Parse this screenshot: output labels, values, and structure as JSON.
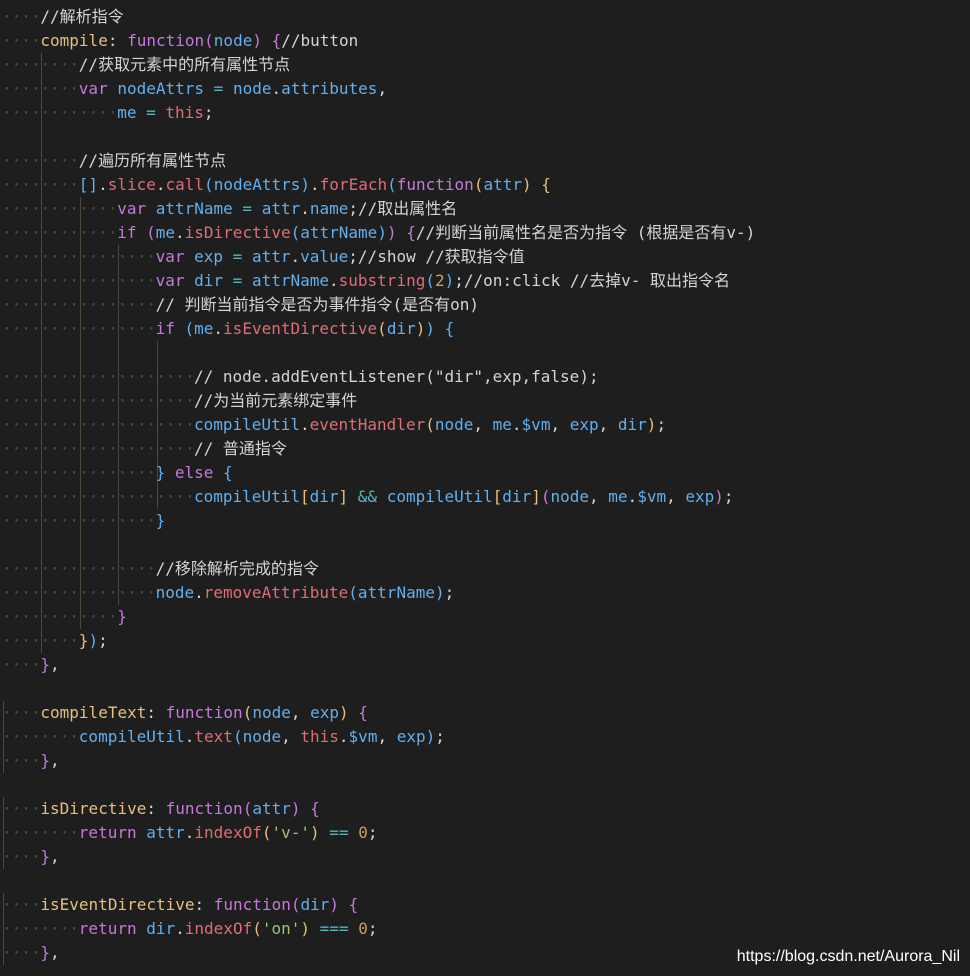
{
  "editor": {
    "lines": [
      [
        {
          "t": "//解析指令",
          "c": "comment"
        }
      ],
      [
        {
          "t": "compile",
          "c": "key"
        },
        {
          "t": ": ",
          "c": "plain"
        },
        {
          "t": "function",
          "c": "kw"
        },
        {
          "t": "(",
          "c": "b2"
        },
        {
          "t": "node",
          "c": "var"
        },
        {
          "t": ") ",
          "c": "b2"
        },
        {
          "t": "{",
          "c": "b2"
        },
        {
          "t": "//button",
          "c": "comment"
        }
      ],
      [
        {
          "t": "//获取元素中的所有属性节点",
          "c": "comment"
        }
      ],
      [
        {
          "t": "var ",
          "c": "kw"
        },
        {
          "t": "nodeAttrs",
          "c": "var"
        },
        {
          "t": " = ",
          "c": "op"
        },
        {
          "t": "node",
          "c": "var"
        },
        {
          "t": ".",
          "c": "plain"
        },
        {
          "t": "attributes",
          "c": "var"
        },
        {
          "t": ",",
          "c": "plain"
        }
      ],
      [
        {
          "t": "me",
          "c": "var"
        },
        {
          "t": " = ",
          "c": "op"
        },
        {
          "t": "this",
          "c": "this"
        },
        {
          "t": ";",
          "c": "plain"
        }
      ],
      [],
      [
        {
          "t": "//遍历所有属性节点",
          "c": "comment"
        }
      ],
      [
        {
          "t": "[]",
          "c": "b3"
        },
        {
          "t": ".",
          "c": "plain"
        },
        {
          "t": "slice",
          "c": "fn"
        },
        {
          "t": ".",
          "c": "plain"
        },
        {
          "t": "call",
          "c": "fn"
        },
        {
          "t": "(",
          "c": "b3"
        },
        {
          "t": "nodeAttrs",
          "c": "var"
        },
        {
          "t": ")",
          "c": "b3"
        },
        {
          "t": ".",
          "c": "plain"
        },
        {
          "t": "forEach",
          "c": "fn"
        },
        {
          "t": "(",
          "c": "b3"
        },
        {
          "t": "function",
          "c": "kw"
        },
        {
          "t": "(",
          "c": "b1"
        },
        {
          "t": "attr",
          "c": "var"
        },
        {
          "t": ") ",
          "c": "b1"
        },
        {
          "t": "{",
          "c": "b1"
        }
      ],
      [
        {
          "t": "var ",
          "c": "kw"
        },
        {
          "t": "attrName",
          "c": "var"
        },
        {
          "t": " = ",
          "c": "op"
        },
        {
          "t": "attr",
          "c": "var"
        },
        {
          "t": ".",
          "c": "plain"
        },
        {
          "t": "name",
          "c": "var"
        },
        {
          "t": ";",
          "c": "plain"
        },
        {
          "t": "//取出属性名",
          "c": "comment"
        }
      ],
      [
        {
          "t": "if ",
          "c": "kw"
        },
        {
          "t": "(",
          "c": "b2"
        },
        {
          "t": "me",
          "c": "var"
        },
        {
          "t": ".",
          "c": "plain"
        },
        {
          "t": "isDirective",
          "c": "fn"
        },
        {
          "t": "(",
          "c": "b3"
        },
        {
          "t": "attrName",
          "c": "var"
        },
        {
          "t": ")",
          "c": "b3"
        },
        {
          "t": ")",
          "c": "b2"
        },
        {
          "t": " {",
          "c": "b2"
        },
        {
          "t": "//判断当前属性名是否为指令 (根据是否有v-)",
          "c": "comment"
        }
      ],
      [
        {
          "t": "var ",
          "c": "kw"
        },
        {
          "t": "exp",
          "c": "var"
        },
        {
          "t": " = ",
          "c": "op"
        },
        {
          "t": "attr",
          "c": "var"
        },
        {
          "t": ".",
          "c": "plain"
        },
        {
          "t": "value",
          "c": "var"
        },
        {
          "t": ";",
          "c": "plain"
        },
        {
          "t": "//show //获取指令值",
          "c": "comment"
        }
      ],
      [
        {
          "t": "var ",
          "c": "kw"
        },
        {
          "t": "dir",
          "c": "var"
        },
        {
          "t": " = ",
          "c": "op"
        },
        {
          "t": "attrName",
          "c": "var"
        },
        {
          "t": ".",
          "c": "plain"
        },
        {
          "t": "substring",
          "c": "fn"
        },
        {
          "t": "(",
          "c": "b3"
        },
        {
          "t": "2",
          "c": "num"
        },
        {
          "t": ")",
          "c": "b3"
        },
        {
          "t": ";",
          "c": "plain"
        },
        {
          "t": "//on:click //去掉v- 取出指令名",
          "c": "comment"
        }
      ],
      [
        {
          "t": "// 判断当前指令是否为事件指令(是否有on)",
          "c": "comment"
        }
      ],
      [
        {
          "t": "if ",
          "c": "kw"
        },
        {
          "t": "(",
          "c": "b3"
        },
        {
          "t": "me",
          "c": "var"
        },
        {
          "t": ".",
          "c": "plain"
        },
        {
          "t": "isEventDirective",
          "c": "fn"
        },
        {
          "t": "(",
          "c": "b1"
        },
        {
          "t": "dir",
          "c": "var"
        },
        {
          "t": ")",
          "c": "b1"
        },
        {
          "t": ")",
          "c": "b3"
        },
        {
          "t": " {",
          "c": "b3"
        }
      ],
      [],
      [
        {
          "t": "// node.addEventListener(\"dir\",exp,false);",
          "c": "comment"
        }
      ],
      [
        {
          "t": "//为当前元素绑定事件",
          "c": "comment"
        }
      ],
      [
        {
          "t": "compileUtil",
          "c": "var"
        },
        {
          "t": ".",
          "c": "plain"
        },
        {
          "t": "eventHandler",
          "c": "fn"
        },
        {
          "t": "(",
          "c": "b1"
        },
        {
          "t": "node",
          "c": "var"
        },
        {
          "t": ", ",
          "c": "plain"
        },
        {
          "t": "me",
          "c": "var"
        },
        {
          "t": ".",
          "c": "plain"
        },
        {
          "t": "$vm",
          "c": "var"
        },
        {
          "t": ", ",
          "c": "plain"
        },
        {
          "t": "exp",
          "c": "var"
        },
        {
          "t": ", ",
          "c": "plain"
        },
        {
          "t": "dir",
          "c": "var"
        },
        {
          "t": ")",
          "c": "b1"
        },
        {
          "t": ";",
          "c": "plain"
        }
      ],
      [
        {
          "t": "// 普通指令",
          "c": "comment"
        }
      ],
      [
        {
          "t": "}",
          "c": "b3"
        },
        {
          "t": " else ",
          "c": "kw"
        },
        {
          "t": "{",
          "c": "b3"
        }
      ],
      [
        {
          "t": "compileUtil",
          "c": "var"
        },
        {
          "t": "[",
          "c": "b1"
        },
        {
          "t": "dir",
          "c": "var"
        },
        {
          "t": "]",
          "c": "b1"
        },
        {
          "t": " && ",
          "c": "op"
        },
        {
          "t": "compileUtil",
          "c": "var"
        },
        {
          "t": "[",
          "c": "b1"
        },
        {
          "t": "dir",
          "c": "var"
        },
        {
          "t": "]",
          "c": "b1"
        },
        {
          "t": "(",
          "c": "b2"
        },
        {
          "t": "node",
          "c": "var"
        },
        {
          "t": ", ",
          "c": "plain"
        },
        {
          "t": "me",
          "c": "var"
        },
        {
          "t": ".",
          "c": "plain"
        },
        {
          "t": "$vm",
          "c": "var"
        },
        {
          "t": ", ",
          "c": "plain"
        },
        {
          "t": "exp",
          "c": "var"
        },
        {
          "t": ")",
          "c": "b2"
        },
        {
          "t": ";",
          "c": "plain"
        }
      ],
      [
        {
          "t": "}",
          "c": "b3"
        }
      ],
      [],
      [
        {
          "t": "//移除解析完成的指令",
          "c": "comment"
        }
      ],
      [
        {
          "t": "node",
          "c": "var"
        },
        {
          "t": ".",
          "c": "plain"
        },
        {
          "t": "removeAttribute",
          "c": "fn"
        },
        {
          "t": "(",
          "c": "b3"
        },
        {
          "t": "attrName",
          "c": "var"
        },
        {
          "t": ")",
          "c": "b3"
        },
        {
          "t": ";",
          "c": "plain"
        }
      ],
      [
        {
          "t": "}",
          "c": "b2"
        }
      ],
      [
        {
          "t": "}",
          "c": "b1"
        },
        {
          "t": ")",
          "c": "b3"
        },
        {
          "t": ";",
          "c": "plain"
        }
      ],
      [
        {
          "t": "}",
          "c": "b2"
        },
        {
          "t": ",",
          "c": "plain"
        }
      ],
      [],
      [
        {
          "t": "compileText",
          "c": "key"
        },
        {
          "t": ": ",
          "c": "plain"
        },
        {
          "t": "function",
          "c": "kw"
        },
        {
          "t": "(",
          "c": "b1"
        },
        {
          "t": "node",
          "c": "var"
        },
        {
          "t": ", ",
          "c": "plain"
        },
        {
          "t": "exp",
          "c": "var"
        },
        {
          "t": ") ",
          "c": "b1"
        },
        {
          "t": "{",
          "c": "b2"
        }
      ],
      [
        {
          "t": "compileUtil",
          "c": "var"
        },
        {
          "t": ".",
          "c": "plain"
        },
        {
          "t": "text",
          "c": "fn"
        },
        {
          "t": "(",
          "c": "b3"
        },
        {
          "t": "node",
          "c": "var"
        },
        {
          "t": ", ",
          "c": "plain"
        },
        {
          "t": "this",
          "c": "this"
        },
        {
          "t": ".",
          "c": "plain"
        },
        {
          "t": "$vm",
          "c": "var"
        },
        {
          "t": ", ",
          "c": "plain"
        },
        {
          "t": "exp",
          "c": "var"
        },
        {
          "t": ")",
          "c": "b3"
        },
        {
          "t": ";",
          "c": "plain"
        }
      ],
      [
        {
          "t": "}",
          "c": "b2"
        },
        {
          "t": ",",
          "c": "plain"
        }
      ],
      [],
      [
        {
          "t": "isDirective",
          "c": "key"
        },
        {
          "t": ": ",
          "c": "plain"
        },
        {
          "t": "function",
          "c": "kw"
        },
        {
          "t": "(",
          "c": "b2"
        },
        {
          "t": "attr",
          "c": "var"
        },
        {
          "t": ") ",
          "c": "b2"
        },
        {
          "t": "{",
          "c": "b2"
        }
      ],
      [
        {
          "t": "return ",
          "c": "kw"
        },
        {
          "t": "attr",
          "c": "var"
        },
        {
          "t": ".",
          "c": "plain"
        },
        {
          "t": "indexOf",
          "c": "fn"
        },
        {
          "t": "(",
          "c": "b1"
        },
        {
          "t": "'v-'",
          "c": "str"
        },
        {
          "t": ")",
          "c": "b1"
        },
        {
          "t": " == ",
          "c": "op"
        },
        {
          "t": "0",
          "c": "num"
        },
        {
          "t": ";",
          "c": "plain"
        }
      ],
      [
        {
          "t": "}",
          "c": "b2"
        },
        {
          "t": ",",
          "c": "plain"
        }
      ],
      [],
      [
        {
          "t": "isEventDirective",
          "c": "key"
        },
        {
          "t": ": ",
          "c": "plain"
        },
        {
          "t": "function",
          "c": "kw"
        },
        {
          "t": "(",
          "c": "b2"
        },
        {
          "t": "dir",
          "c": "var"
        },
        {
          "t": ") ",
          "c": "b2"
        },
        {
          "t": "{",
          "c": "b2"
        }
      ],
      [
        {
          "t": "return ",
          "c": "kw"
        },
        {
          "t": "dir",
          "c": "var"
        },
        {
          "t": ".",
          "c": "plain"
        },
        {
          "t": "indexOf",
          "c": "fn"
        },
        {
          "t": "(",
          "c": "b1"
        },
        {
          "t": "'on'",
          "c": "str"
        },
        {
          "t": ")",
          "c": "b1"
        },
        {
          "t": " === ",
          "c": "op"
        },
        {
          "t": "0",
          "c": "num"
        },
        {
          "t": ";",
          "c": "plain"
        }
      ],
      [
        {
          "t": "}",
          "c": "b2"
        },
        {
          "t": ",",
          "c": "plain"
        }
      ]
    ]
  },
  "watermark": "https://blog.csdn.net/Aurora_Nil"
}
